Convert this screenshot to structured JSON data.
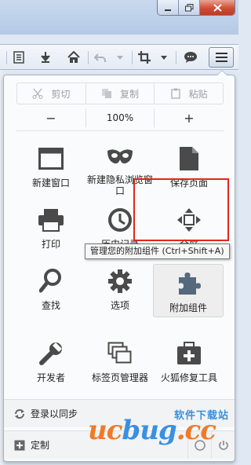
{
  "toolbar": {
    "icons": [
      "reader-icon",
      "download-icon",
      "home-icon",
      "undo-icon",
      "dropdown-icon",
      "crop-icon",
      "dropdown-icon",
      "chat-icon",
      "menu-icon"
    ]
  },
  "panel": {
    "edit": {
      "cut": "剪切",
      "copy": "复制",
      "paste": "粘贴"
    },
    "zoom": {
      "minus": "−",
      "value": "100%",
      "plus": "+"
    },
    "grid": [
      {
        "label": "新建窗口",
        "icon": "new-window-icon"
      },
      {
        "label": "新建隐私浏览窗口",
        "icon": "private-mask-icon"
      },
      {
        "label": "保存页面",
        "icon": "save-page-icon"
      },
      {
        "label": "打印",
        "icon": "printer-icon"
      },
      {
        "label": "历史记录",
        "icon": "history-clock-icon"
      },
      {
        "label": "全屏",
        "icon": "fullscreen-icon"
      },
      {
        "label": "查找",
        "icon": "search-icon"
      },
      {
        "label": "选项",
        "icon": "gear-icon"
      },
      {
        "label": "附加组件",
        "icon": "puzzle-icon"
      },
      {
        "label": "开发者",
        "icon": "wrench-icon"
      },
      {
        "label": "标签页管理器",
        "icon": "tab-manager-icon"
      },
      {
        "label": "火狐修复工具",
        "icon": "repair-kit-icon"
      }
    ],
    "tooltip": "管理您的附加组件 (Ctrl+Shift+A)",
    "sync_label": "登录以同步",
    "customize_label": "定制"
  },
  "watermark": {
    "top": "软件下载站",
    "main_a": "uc",
    "main_b": "bug",
    "main_c": ".cc"
  },
  "colors": {
    "highlight_box": "#e0261c",
    "accent": "#3a8fe0"
  }
}
